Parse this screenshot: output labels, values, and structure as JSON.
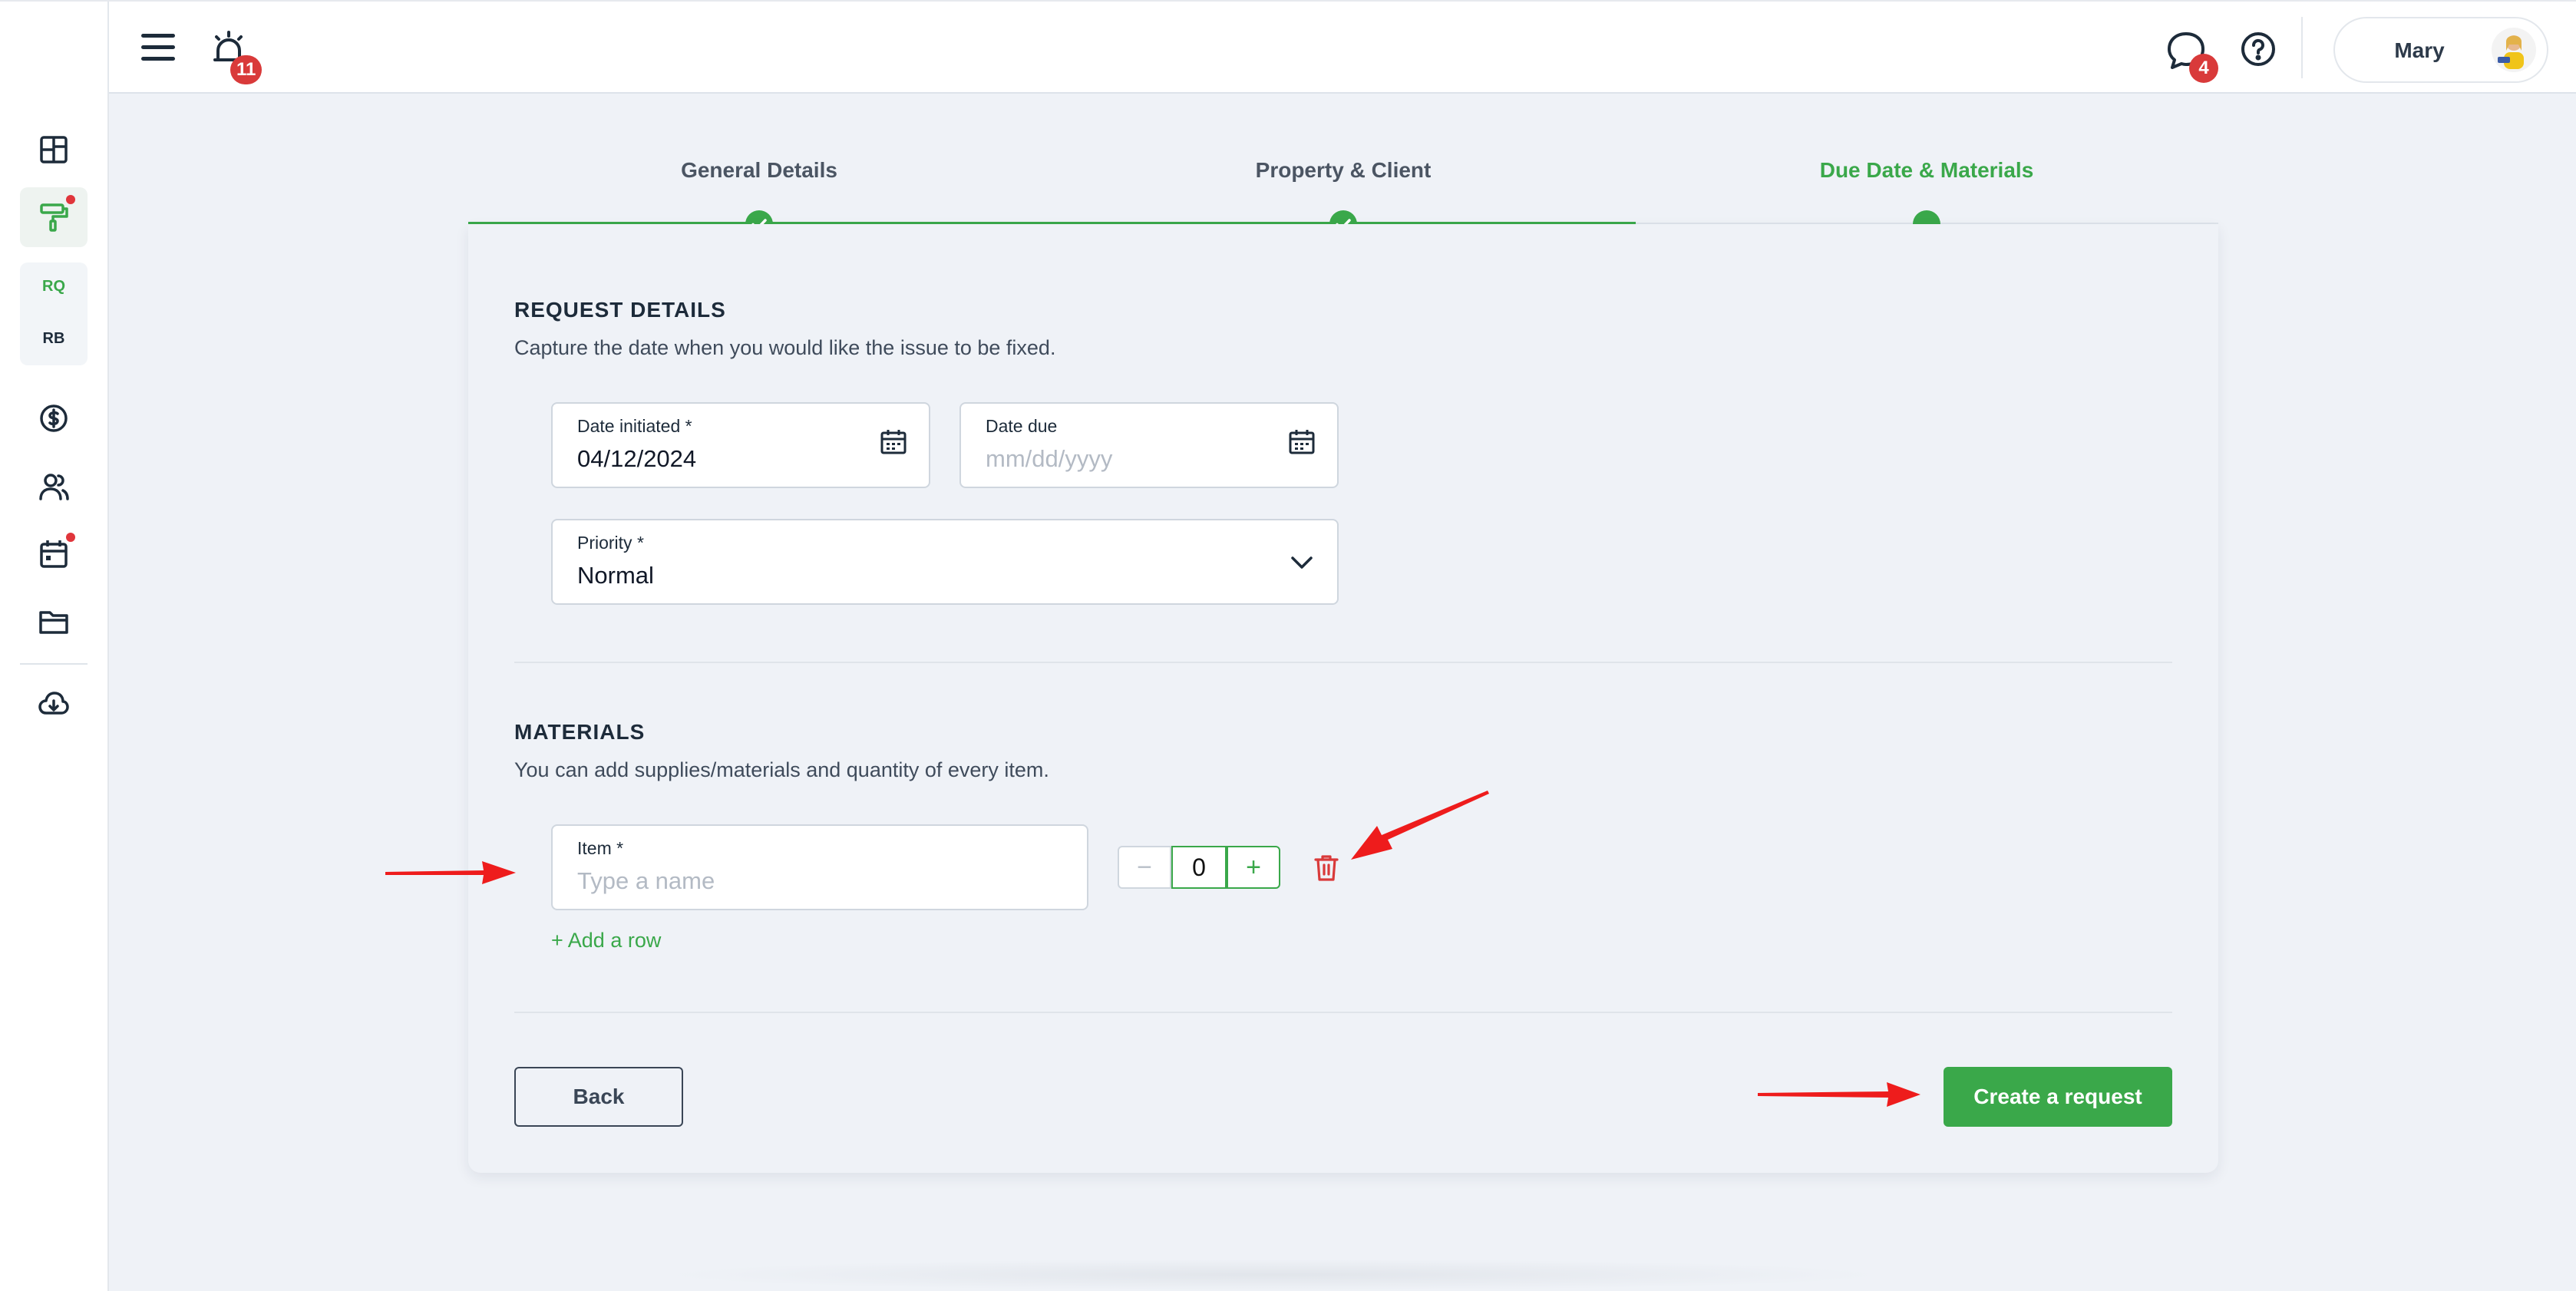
{
  "header": {
    "alarm_count": "11",
    "messages_count": "4",
    "user_name": "Mary"
  },
  "sidebar": {
    "items": [
      {
        "icon": "dashboard-icon"
      },
      {
        "icon": "paint-roller-icon",
        "active": true,
        "has_dot": true
      },
      {
        "icon": "dollar-icon"
      },
      {
        "icon": "users-icon"
      },
      {
        "icon": "calendar-icon",
        "has_dot": true
      },
      {
        "icon": "folder-icon"
      },
      {
        "icon": "cloud-download-icon"
      }
    ],
    "sub_items": [
      {
        "label": "RQ",
        "color": "#3aa84a"
      },
      {
        "label": "RB",
        "color": "#1d2b3a"
      }
    ]
  },
  "stepper": {
    "steps": [
      {
        "label": "General Details",
        "state": "done"
      },
      {
        "label": "Property & Client",
        "state": "done"
      },
      {
        "label": "Due Date & Materials",
        "state": "current"
      }
    ],
    "progress_fraction": 0.667
  },
  "request_details": {
    "title": "REQUEST DETAILS",
    "description": "Capture the date when you would like the issue to be fixed.",
    "date_initiated": {
      "label": "Date initiated *",
      "value": "04/12/2024"
    },
    "date_due": {
      "label": "Date due",
      "placeholder": "mm/dd/yyyy"
    },
    "priority": {
      "label": "Priority *",
      "value": "Normal"
    }
  },
  "materials": {
    "title": "MATERIALS",
    "description": "You can add supplies/materials and quantity of every item.",
    "item": {
      "label": "Item *",
      "placeholder": "Type a name"
    },
    "quantity": "0",
    "minus_symbol": "−",
    "plus_symbol": "+",
    "add_row_label": "+ Add a row"
  },
  "actions": {
    "back_label": "Back",
    "create_label": "Create a request"
  },
  "colors": {
    "accent": "#3aa84a",
    "danger": "#d93a3a",
    "annotation_arrow": "#ee1c1c"
  }
}
